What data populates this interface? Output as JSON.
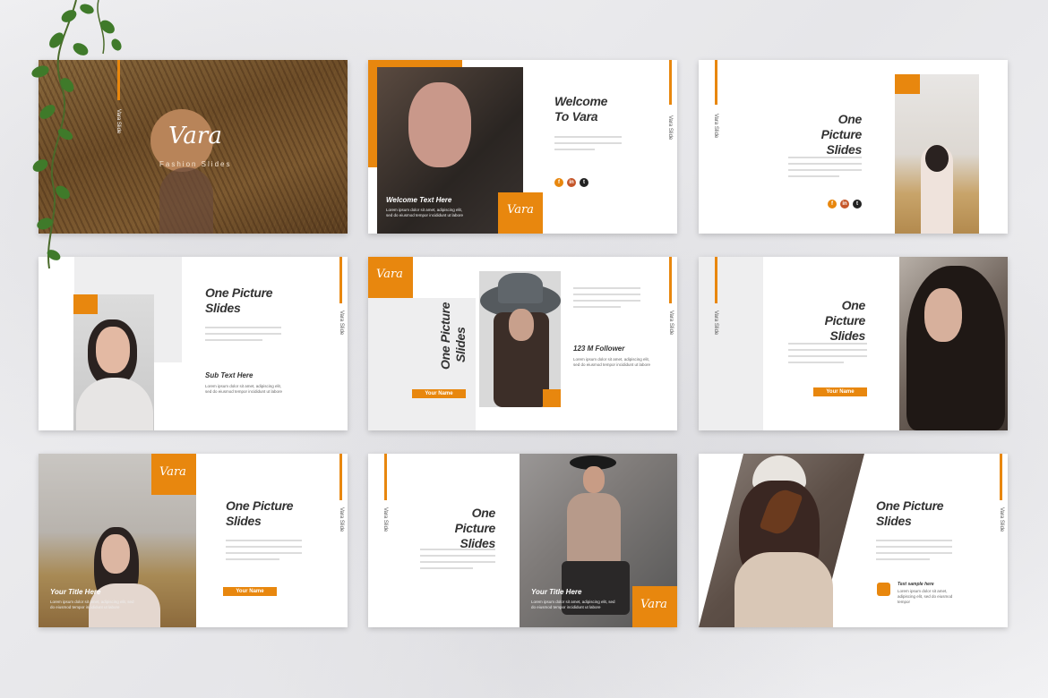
{
  "brand": "Vara",
  "accent": "#e8870e",
  "slides": {
    "cover": {
      "logo": "Vara",
      "subtitle": "Fashion Slides",
      "vertical": "Vara Slide"
    },
    "welcome": {
      "title_l1": "Welcome",
      "title_l2": "To Vara",
      "sub": "Welcome Text Here",
      "logo": "Vara",
      "vertical": "Vara Slide",
      "body": "Lorem ipsum dolor sit amet, adipiscing elit, sed do eiusmod tempor incididunt ut labore"
    },
    "s3": {
      "title_l1": "One Picture",
      "title_l2": "Slides",
      "vertical": "Vara Slide"
    },
    "s4": {
      "title_l1": "One Picture",
      "title_l2": "Slides",
      "sub": "Sub Text Here",
      "vertical": "Vara Slide",
      "body": "Lorem ipsum dolor sit amet, adipiscing elit, sed do eiusmod tempor incididunt ut labore"
    },
    "s5": {
      "logo": "Vara",
      "title_l1": "One Picture",
      "title_l2": "Slides",
      "follower": "123 M Follower",
      "button": "Your Name",
      "vertical": "Vara Slide",
      "body": "Lorem ipsum dolor sit amet, adipiscing elit, sed do eiusmod tempor incididunt ut labore"
    },
    "s6": {
      "title_l1": "One Picture",
      "title_l2": "Slides",
      "button": "Your Name",
      "vertical": "Vara Slide"
    },
    "s7": {
      "logo": "Vara",
      "title_l1": "One Picture",
      "title_l2": "Slides",
      "sub": "Your Title Here",
      "button": "Your Name",
      "vertical": "Vara Slide",
      "body": "Lorem ipsum dolor sit amet, adipiscing elit, sed do eiusmod tempor incididunt ut labore"
    },
    "s8": {
      "logo": "Vara",
      "title_l1": "One Picture",
      "title_l2": "Slides",
      "sub": "Your Title Here",
      "vertical": "Vara Slide",
      "body": "Lorem ipsum dolor sit amet, adipiscing elit, sed do eiusmod tempor incididunt ut labore"
    },
    "s9": {
      "title_l1": "One Picture",
      "title_l2": "Slides",
      "caption": "Text sample here",
      "vertical": "Vara Slide",
      "body": "Lorem ipsum dolor sit amet, adipiscing elit, sed do eiusmod tempor"
    }
  },
  "social_icons": [
    "facebook-icon",
    "linkedin-icon",
    "twitter-icon"
  ]
}
